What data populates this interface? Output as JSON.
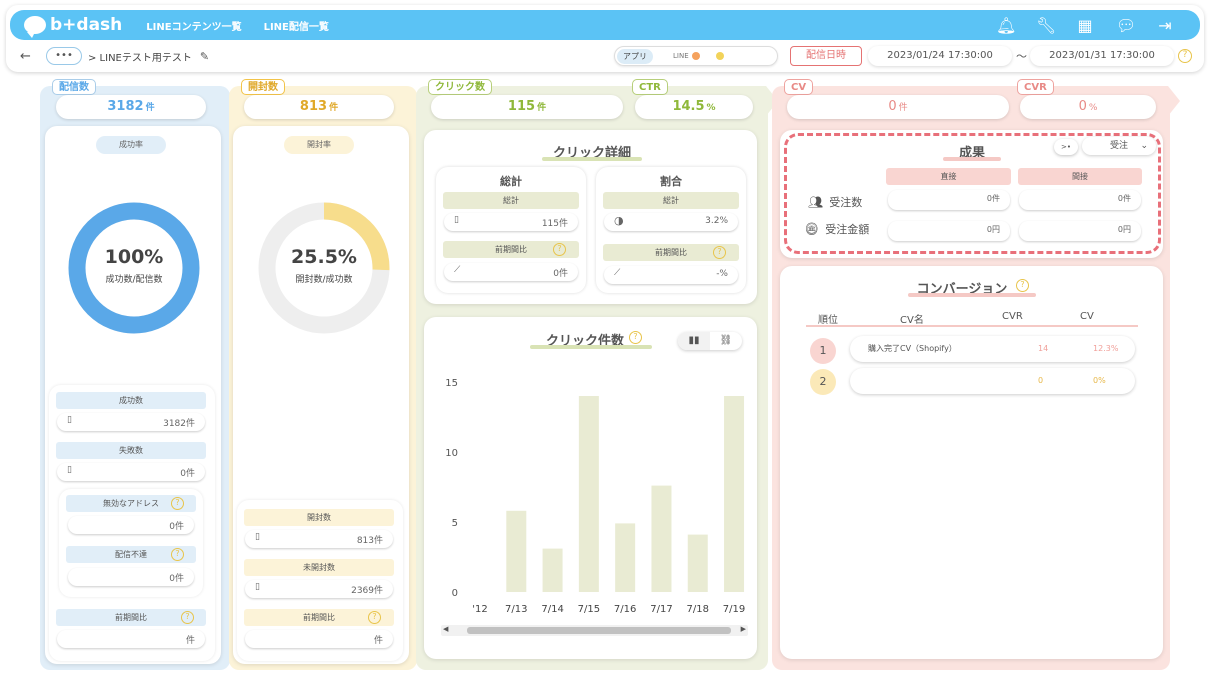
{
  "header": {
    "brand": "b+dash",
    "nav": [
      "LINEコンテンツ一覧",
      "LINE配信一覧"
    ],
    "icons": [
      "bell-icon",
      "wrench-icon",
      "grid-icon",
      "chat-icon",
      "logout-icon"
    ]
  },
  "subbar": {
    "back": "←",
    "more": "•••",
    "breadcrumb": "> LINEテスト用テスト",
    "segment_active": "アプリ",
    "segment_line": "LINE",
    "deliver_date_label": "配信日時",
    "date_from": "2023/01/24 17:30:00",
    "tilde": "〜",
    "date_to": "2023/01/31 17:30:00"
  },
  "delivery": {
    "tag": "配信数",
    "value": "3182",
    "unit": "件",
    "rate_label": "成功率",
    "donut_pct": "100%",
    "donut_sub": "成功数/配信数",
    "donut_fraction": 1.0,
    "success_label": "成功数",
    "success_value": "3182件",
    "fail_label": "失敗数",
    "fail_value": "0件",
    "invalid_label": "無効なアドレス",
    "invalid_value": "0件",
    "undeliverable_label": "配信不達",
    "undeliverable_value": "0件",
    "prev_label": "前期間比",
    "prev_value": "件"
  },
  "open": {
    "tag": "開封数",
    "value": "813",
    "unit": "件",
    "rate_label": "開封率",
    "donut_pct": "25.5%",
    "donut_sub": "開封数/成功数",
    "donut_fraction": 0.255,
    "opened_label": "開封数",
    "opened_value": "813件",
    "unopened_label": "未開封数",
    "unopened_value": "2369件",
    "prev_label": "前期間比",
    "prev_value": "件"
  },
  "click": {
    "tag": "クリック数",
    "value": "115",
    "unit": "件",
    "ctr_tag": "CTR",
    "ctr_value": "14.5",
    "ctr_unit": "%",
    "detail_title": "クリック詳細",
    "total_title": "総計",
    "total_sub": "総計",
    "total_value": "115件",
    "total_prev_label": "前期間比",
    "total_prev_value": "0件",
    "ratio_title": "割合",
    "ratio_sub": "総計",
    "ratio_value": "3.2%",
    "ratio_prev_label": "前期間比",
    "ratio_prev_value": "-%",
    "chart_title": "クリック件数"
  },
  "cv": {
    "tag": "CV",
    "value": "0",
    "unit": "件",
    "cvr_tag": "CVR",
    "cvr_value": "0",
    "cvr_unit": "%",
    "result_title": "成果",
    "toggle": ">•",
    "select_value": "受注",
    "col1": "直接",
    "col2": "間接",
    "orders_label": "受注数",
    "amount_label": "受注金額",
    "orders_direct": "0件",
    "orders_indirect": "0件",
    "amount_direct": "0円",
    "amount_indirect": "0円",
    "conversion_title": "コンバージョン",
    "table_headers": [
      "順位",
      "CV名",
      "CVR",
      "CV"
    ],
    "rows": [
      {
        "rank": "1",
        "name": "購入完了CV（Shopify）",
        "cvr": "14",
        "cv": "12.3%"
      },
      {
        "rank": "2",
        "name": "",
        "cvr": "0",
        "cv": "0%"
      }
    ]
  },
  "chart_data": {
    "type": "bar",
    "title": "クリック件数",
    "categories": [
      "7/12",
      "7/13",
      "7/14",
      "7/15",
      "7/16",
      "7/17",
      "7/18",
      "7/19"
    ],
    "category_labels": [
      "'12",
      "7/13",
      "7/14",
      "7/15",
      "7/16",
      "7/17",
      "7/18",
      "7/19"
    ],
    "values": [
      0,
      5.8,
      3.1,
      14,
      4.9,
      7.6,
      4.1,
      14
    ],
    "ylim": [
      0,
      15
    ],
    "yticks": [
      "0",
      "5",
      "10",
      "15"
    ],
    "grid": false,
    "bar_color": "#e9ebd3"
  },
  "colors": {
    "topbar": "#5bc3f5",
    "blue_panel": "#e1eef8",
    "yellow_panel": "#fcf3d8",
    "green_panel": "#eef1e0",
    "red_panel": "#fbe3df",
    "blue_accent": "#5aa8e8",
    "yellow_accent": "#f2c44a",
    "green_accent": "#8fb83a",
    "red_accent": "#e88a86"
  }
}
